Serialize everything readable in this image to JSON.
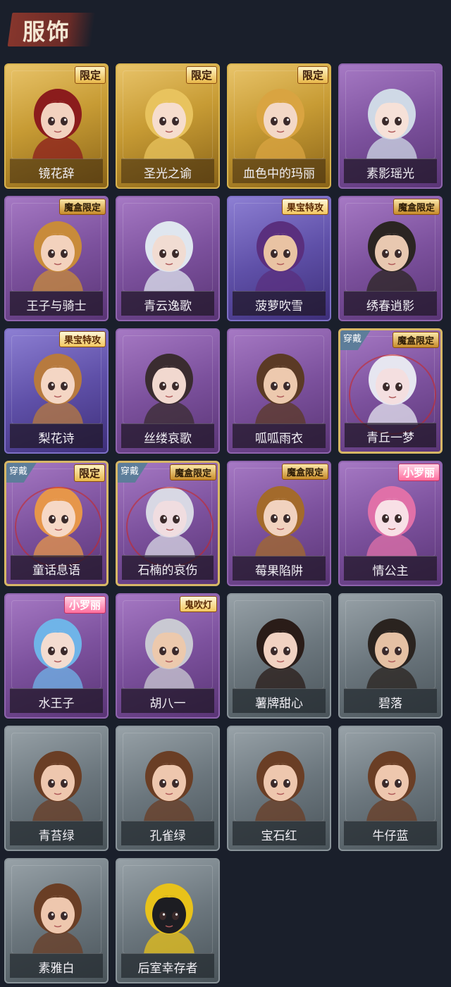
{
  "header": {
    "title": "服饰"
  },
  "items": [
    {
      "name": "镜花辞",
      "rarity": "gold",
      "badge": "限定",
      "badge_style": "normal",
      "equipped": false,
      "skin": "#f2d2bf",
      "hair": "#8b1c1c"
    },
    {
      "name": "圣光之谕",
      "rarity": "gold",
      "badge": "限定",
      "badge_style": "normal",
      "equipped": false,
      "skin": "#f6ddcd",
      "hair": "#e8c35e"
    },
    {
      "name": "血色中的玛丽",
      "rarity": "gold",
      "badge": "限定",
      "badge_style": "normal",
      "equipped": false,
      "skin": "#f3d8c6",
      "hair": "#d9a441"
    },
    {
      "name": "素影瑶光",
      "rarity": "purple",
      "badge": "",
      "badge_style": "",
      "equipped": false,
      "skin": "#f6e1d8",
      "hair": "#cfd9e6"
    },
    {
      "name": "王子与骑士",
      "rarity": "purple",
      "badge": "魔盒限定",
      "badge_style": "dark",
      "equipped": false,
      "skin": "#f3d2bd",
      "hair": "#c88b3a"
    },
    {
      "name": "青云逸歌",
      "rarity": "purple",
      "badge": "",
      "badge_style": "",
      "equipped": false,
      "skin": "#f1dcd2",
      "hair": "#dfe6ef"
    },
    {
      "name": "菠萝吹雪",
      "rarity": "blue",
      "badge": "果宝特攻",
      "badge_style": "event",
      "equipped": false,
      "skin": "#e9c3a3",
      "hair": "#5a2f7e"
    },
    {
      "name": "绣春逍影",
      "rarity": "purple",
      "badge": "魔盒限定",
      "badge_style": "dark",
      "equipped": false,
      "skin": "#e8c8b0",
      "hair": "#2b2522"
    },
    {
      "name": "梨花诗",
      "rarity": "blue",
      "badge": "果宝特攻",
      "badge_style": "event",
      "equipped": false,
      "skin": "#f4d6c4",
      "hair": "#b77a3e"
    },
    {
      "name": "丝缕哀歌",
      "rarity": "purple",
      "badge": "",
      "badge_style": "",
      "equipped": false,
      "skin": "#f1d8cf",
      "hair": "#3a2c30"
    },
    {
      "name": "呱呱雨衣",
      "rarity": "purple",
      "badge": "",
      "badge_style": "",
      "equipped": false,
      "skin": "#edc9ae",
      "hair": "#5b3a25"
    },
    {
      "name": "青丘一梦",
      "rarity": "purple",
      "badge": "魔盒限定",
      "badge_style": "dark",
      "equipped": true,
      "skin": "#f4dfe0",
      "hair": "#e6e6f0"
    },
    {
      "name": "童话息语",
      "rarity": "purple",
      "badge": "限定",
      "badge_style": "normal",
      "equipped": true,
      "skin": "#f6d8c6",
      "hair": "#e6964a"
    },
    {
      "name": "石楠的哀伤",
      "rarity": "purple",
      "badge": "魔盒限定",
      "badge_style": "dark",
      "equipped": true,
      "skin": "#f0dde0",
      "hair": "#d8d8e4"
    },
    {
      "name": "莓果陷阱",
      "rarity": "purple",
      "badge": "魔盒限定",
      "badge_style": "dark",
      "equipped": false,
      "skin": "#f1d2bf",
      "hair": "#a36a2b"
    },
    {
      "name": "情公主",
      "rarity": "purple",
      "badge": "小罗丽",
      "badge_style": "pink",
      "equipped": false,
      "skin": "#f8e0e6",
      "hair": "#e070a8"
    },
    {
      "name": "水王子",
      "rarity": "purple",
      "badge": "小罗丽",
      "badge_style": "pink",
      "equipped": false,
      "skin": "#f3dcd0",
      "hair": "#6fb4e8"
    },
    {
      "name": "胡八一",
      "rarity": "purple",
      "badge": "鬼吹灯",
      "badge_style": "event",
      "equipped": false,
      "skin": "#ecc9ad",
      "hair": "#c9c9d2"
    },
    {
      "name": "薯牌甜心",
      "rarity": "gray",
      "badge": "",
      "badge_style": "",
      "equipped": false,
      "skin": "#f1d2c2",
      "hair": "#2a1c18"
    },
    {
      "name": "碧落",
      "rarity": "gray",
      "badge": "",
      "badge_style": "",
      "equipped": false,
      "skin": "#e5c1a4",
      "hair": "#2a231f"
    },
    {
      "name": "青苔绿",
      "rarity": "gray",
      "badge": "",
      "badge_style": "",
      "equipped": false,
      "skin": "#eec7ae",
      "hair": "#6a3e25"
    },
    {
      "name": "孔雀绿",
      "rarity": "gray",
      "badge": "",
      "badge_style": "",
      "equipped": false,
      "skin": "#eec7ae",
      "hair": "#6a3e25"
    },
    {
      "name": "宝石红",
      "rarity": "gray",
      "badge": "",
      "badge_style": "",
      "equipped": false,
      "skin": "#eec7ae",
      "hair": "#6a3e25"
    },
    {
      "name": "牛仔蓝",
      "rarity": "gray",
      "badge": "",
      "badge_style": "",
      "equipped": false,
      "skin": "#eec7ae",
      "hair": "#6a3e25"
    },
    {
      "name": "素雅白",
      "rarity": "gray",
      "badge": "",
      "badge_style": "",
      "equipped": false,
      "skin": "#eec7ae",
      "hair": "#6a3e25"
    },
    {
      "name": "后室幸存者",
      "rarity": "gray",
      "badge": "",
      "badge_style": "",
      "equipped": false,
      "skin": "#1d1d22",
      "hair": "#e8c21a"
    }
  ],
  "equipped_label": "穿戴",
  "colors": {
    "background": "#1a1f2b",
    "title_banner": "#8c372d",
    "title_text": "#f3e6d3"
  }
}
